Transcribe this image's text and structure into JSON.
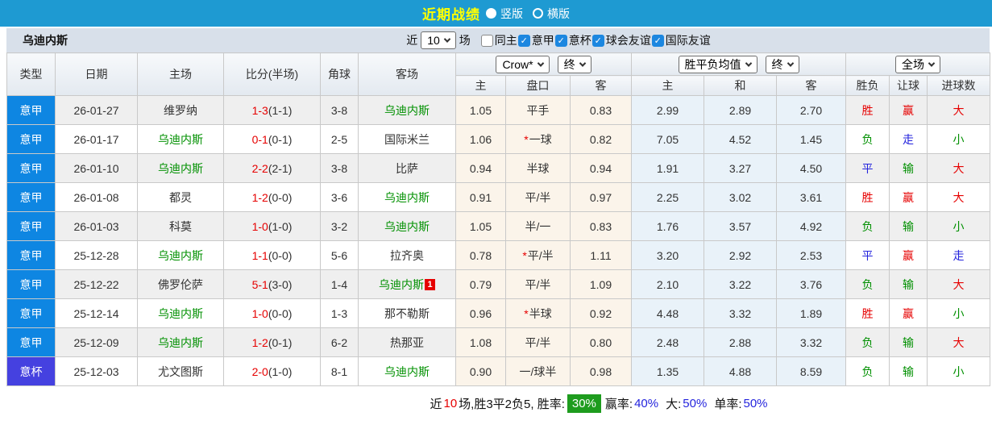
{
  "topbar": {
    "title": "近期战绩",
    "layout_radios": [
      {
        "label": "竖版",
        "selected": true
      },
      {
        "label": "横版",
        "selected": false
      }
    ]
  },
  "filter": {
    "team_name": "乌迪内斯",
    "recent_label": "近",
    "recent_count": "10",
    "matches_label": "场",
    "checkboxes": [
      {
        "label": "同主",
        "checked": false
      },
      {
        "label": "意甲",
        "checked": true
      },
      {
        "label": "意杯",
        "checked": true
      },
      {
        "label": "球会友谊",
        "checked": true
      },
      {
        "label": "国际友谊",
        "checked": true
      }
    ]
  },
  "table": {
    "columns": [
      "类型",
      "日期",
      "主场",
      "比分(半场)",
      "角球",
      "客场"
    ],
    "odds_company_select": "Crow*",
    "odds_stage_select": "终",
    "avg_select": "胜平负均值",
    "avg_stage_select": "终",
    "scope_select": "全场",
    "sub_columns": [
      "主",
      "盘口",
      "客",
      "主",
      "和",
      "客",
      "胜负",
      "让球",
      "进球数"
    ],
    "rows": [
      [
        {
          "t": "意甲",
          "c": "lg-jia"
        },
        {
          "t": "26-01-27"
        },
        {
          "t": "维罗纳"
        },
        {
          "p": [
            {
              "t": "1-3",
              "c": "red"
            },
            {
              "t": "(1-1)"
            }
          ]
        },
        {
          "t": "3-8"
        },
        {
          "t": "乌迪内斯",
          "c": "green"
        },
        {
          "t": "1.05"
        },
        {
          "t": "平手"
        },
        {
          "t": "0.83"
        },
        {
          "t": "2.99"
        },
        {
          "t": "2.89"
        },
        {
          "t": "2.70"
        },
        {
          "t": "胜",
          "c": "red"
        },
        {
          "t": "赢",
          "c": "red"
        },
        {
          "t": "大",
          "c": "red"
        }
      ],
      [
        {
          "t": "意甲",
          "c": "lg-jia"
        },
        {
          "t": "26-01-17"
        },
        {
          "t": "乌迪内斯",
          "c": "green"
        },
        {
          "p": [
            {
              "t": "0-1",
              "c": "red"
            },
            {
              "t": "(0-1)"
            }
          ]
        },
        {
          "t": "2-5"
        },
        {
          "t": "国际米兰"
        },
        {
          "t": "1.06"
        },
        {
          "p": [
            {
              "t": "*",
              "c": "star"
            },
            {
              "t": "一球"
            }
          ]
        },
        {
          "t": "0.82"
        },
        {
          "t": "7.05"
        },
        {
          "t": "4.52"
        },
        {
          "t": "1.45"
        },
        {
          "t": "负",
          "c": "green"
        },
        {
          "t": "走",
          "c": "blue"
        },
        {
          "t": "小",
          "c": "green"
        }
      ],
      [
        {
          "t": "意甲",
          "c": "lg-jia"
        },
        {
          "t": "26-01-10"
        },
        {
          "t": "乌迪内斯",
          "c": "green"
        },
        {
          "p": [
            {
              "t": "2-2",
              "c": "red"
            },
            {
              "t": "(2-1)"
            }
          ]
        },
        {
          "t": "3-8"
        },
        {
          "t": "比萨"
        },
        {
          "t": "0.94"
        },
        {
          "t": "半球"
        },
        {
          "t": "0.94"
        },
        {
          "t": "1.91"
        },
        {
          "t": "3.27"
        },
        {
          "t": "4.50"
        },
        {
          "t": "平",
          "c": "blue"
        },
        {
          "t": "输",
          "c": "green"
        },
        {
          "t": "大",
          "c": "red"
        }
      ],
      [
        {
          "t": "意甲",
          "c": "lg-jia"
        },
        {
          "t": "26-01-08"
        },
        {
          "t": "都灵"
        },
        {
          "p": [
            {
              "t": "1-2",
              "c": "red"
            },
            {
              "t": "(0-0)"
            }
          ]
        },
        {
          "t": "3-6"
        },
        {
          "t": "乌迪内斯",
          "c": "green"
        },
        {
          "t": "0.91"
        },
        {
          "t": "平/半"
        },
        {
          "t": "0.97"
        },
        {
          "t": "2.25"
        },
        {
          "t": "3.02"
        },
        {
          "t": "3.61"
        },
        {
          "t": "胜",
          "c": "red"
        },
        {
          "t": "赢",
          "c": "red"
        },
        {
          "t": "大",
          "c": "red"
        }
      ],
      [
        {
          "t": "意甲",
          "c": "lg-jia"
        },
        {
          "t": "26-01-03"
        },
        {
          "t": "科莫"
        },
        {
          "p": [
            {
              "t": "1-0",
              "c": "red"
            },
            {
              "t": "(1-0)"
            }
          ]
        },
        {
          "t": "3-2"
        },
        {
          "t": "乌迪内斯",
          "c": "green"
        },
        {
          "t": "1.05"
        },
        {
          "t": "半/一"
        },
        {
          "t": "0.83"
        },
        {
          "t": "1.76"
        },
        {
          "t": "3.57"
        },
        {
          "t": "4.92"
        },
        {
          "t": "负",
          "c": "green"
        },
        {
          "t": "输",
          "c": "green"
        },
        {
          "t": "小",
          "c": "green"
        }
      ],
      [
        {
          "t": "意甲",
          "c": "lg-jia"
        },
        {
          "t": "25-12-28"
        },
        {
          "t": "乌迪内斯",
          "c": "green"
        },
        {
          "p": [
            {
              "t": "1-1",
              "c": "red"
            },
            {
              "t": "(0-0)"
            }
          ]
        },
        {
          "t": "5-6"
        },
        {
          "t": "拉齐奥"
        },
        {
          "t": "0.78"
        },
        {
          "p": [
            {
              "t": "*",
              "c": "star"
            },
            {
              "t": "平/半"
            }
          ]
        },
        {
          "t": "1.11"
        },
        {
          "t": "3.20"
        },
        {
          "t": "2.92"
        },
        {
          "t": "2.53"
        },
        {
          "t": "平",
          "c": "blue"
        },
        {
          "t": "赢",
          "c": "red"
        },
        {
          "t": "走",
          "c": "blue"
        }
      ],
      [
        {
          "t": "意甲",
          "c": "lg-jia"
        },
        {
          "t": "25-12-22"
        },
        {
          "t": "佛罗伦萨"
        },
        {
          "p": [
            {
              "t": "5-1",
              "c": "red"
            },
            {
              "t": "(3-0)"
            }
          ]
        },
        {
          "t": "1-4"
        },
        {
          "p": [
            {
              "t": "乌迪内斯",
              "c": "green"
            },
            {
              "t": "1",
              "c": "rc"
            }
          ]
        },
        {
          "t": "0.79"
        },
        {
          "t": "平/半"
        },
        {
          "t": "1.09"
        },
        {
          "t": "2.10"
        },
        {
          "t": "3.22"
        },
        {
          "t": "3.76"
        },
        {
          "t": "负",
          "c": "green"
        },
        {
          "t": "输",
          "c": "green"
        },
        {
          "t": "大",
          "c": "red"
        }
      ],
      [
        {
          "t": "意甲",
          "c": "lg-jia"
        },
        {
          "t": "25-12-14"
        },
        {
          "t": "乌迪内斯",
          "c": "green"
        },
        {
          "p": [
            {
              "t": "1-0",
              "c": "red"
            },
            {
              "t": "(0-0)"
            }
          ]
        },
        {
          "t": "1-3"
        },
        {
          "t": "那不勒斯"
        },
        {
          "t": "0.96"
        },
        {
          "p": [
            {
              "t": "*",
              "c": "star"
            },
            {
              "t": "半球"
            }
          ]
        },
        {
          "t": "0.92"
        },
        {
          "t": "4.48"
        },
        {
          "t": "3.32"
        },
        {
          "t": "1.89"
        },
        {
          "t": "胜",
          "c": "red"
        },
        {
          "t": "赢",
          "c": "red"
        },
        {
          "t": "小",
          "c": "green"
        }
      ],
      [
        {
          "t": "意甲",
          "c": "lg-jia"
        },
        {
          "t": "25-12-09"
        },
        {
          "t": "乌迪内斯",
          "c": "green"
        },
        {
          "p": [
            {
              "t": "1-2",
              "c": "red"
            },
            {
              "t": "(0-1)"
            }
          ]
        },
        {
          "t": "6-2"
        },
        {
          "t": "热那亚"
        },
        {
          "t": "1.08"
        },
        {
          "t": "平/半"
        },
        {
          "t": "0.80"
        },
        {
          "t": "2.48"
        },
        {
          "t": "2.88"
        },
        {
          "t": "3.32"
        },
        {
          "t": "负",
          "c": "green"
        },
        {
          "t": "输",
          "c": "green"
        },
        {
          "t": "大",
          "c": "red"
        }
      ],
      [
        {
          "t": "意杯",
          "c": "lg-bei"
        },
        {
          "t": "25-12-03"
        },
        {
          "t": "尤文图斯"
        },
        {
          "p": [
            {
              "t": "2-0",
              "c": "red"
            },
            {
              "t": "(1-0)"
            }
          ]
        },
        {
          "t": "8-1"
        },
        {
          "t": "乌迪内斯",
          "c": "green"
        },
        {
          "t": "0.90"
        },
        {
          "t": "一/球半"
        },
        {
          "t": "0.98"
        },
        {
          "t": "1.35"
        },
        {
          "t": "4.88"
        },
        {
          "t": "8.59"
        },
        {
          "t": "负",
          "c": "green"
        },
        {
          "t": "输",
          "c": "green"
        },
        {
          "t": "小",
          "c": "green"
        }
      ]
    ]
  },
  "summary": {
    "near_label": "近",
    "near_count": "10",
    "record_text": "场,胜3平2负5, 胜率:",
    "win_rate": "30%",
    "handicap_label": "赢率:",
    "handicap_rate": "40%",
    "big_label": "大:",
    "big_rate": "50%",
    "single_label": "单率:",
    "single_rate": "50%"
  },
  "colors": {
    "topbar_blue": "#1e9ad2",
    "title_yellow": "#ffff00",
    "serie_a_badge": "#0e86e2",
    "coppa_badge": "#4541e0",
    "self_team_green": "#009000",
    "score_red": "#e60000",
    "draw_blue": "#2424dd",
    "win_rate_box_green": "#1e9c1e"
  }
}
